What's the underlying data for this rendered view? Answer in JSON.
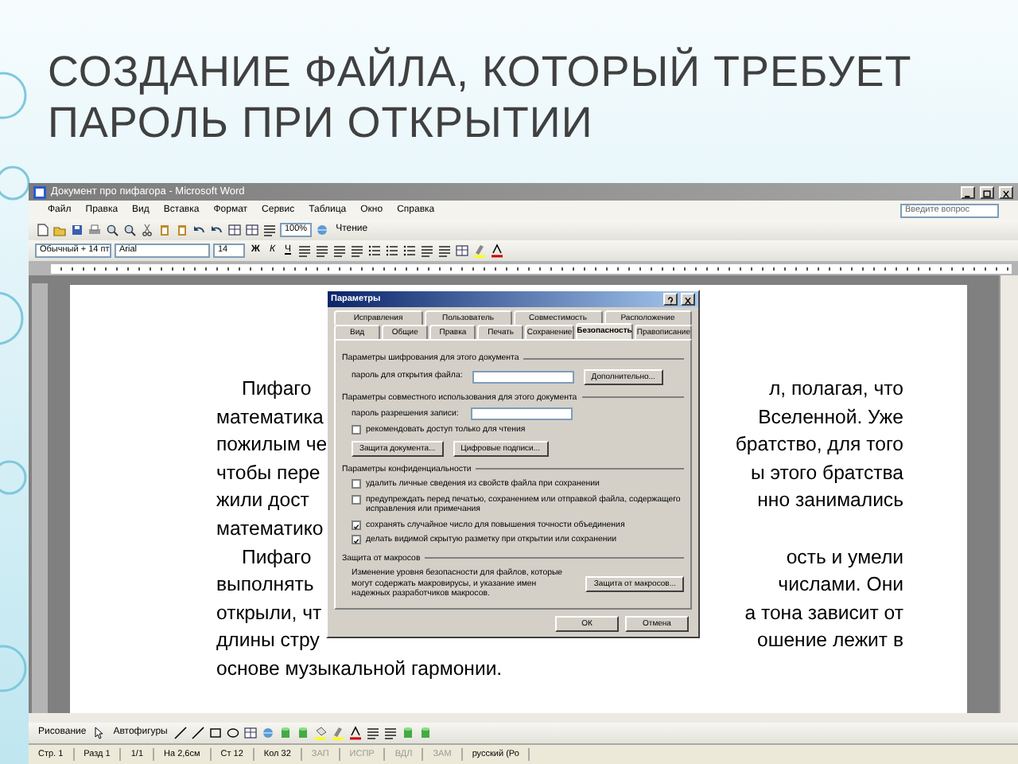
{
  "slide": {
    "title": "СОЗДАНИЕ ФАЙЛА, КОТОРЫЙ ТРЕБУЕТ ПАРОЛЬ ПРИ ОТКРЫТИИ"
  },
  "word": {
    "title": "Документ про пифагора - Microsoft Word",
    "menu": [
      "Файл",
      "Правка",
      "Вид",
      "Вставка",
      "Формат",
      "Сервис",
      "Таблица",
      "Окно",
      "Справка"
    ],
    "help_field": {
      "placeholder": "Введите вопрос"
    },
    "standard_toolbar": {
      "zoom": "100%",
      "read_button": "Чтение"
    },
    "formatting_toolbar": {
      "style": "Обычный + 14 пт",
      "font": "Arial",
      "size": "14",
      "format_buttons": [
        "Ж",
        "К",
        "Ч"
      ]
    },
    "document": {
      "lines": [
        {
          "left": "Пифаго",
          "right": "л, полагая, что",
          "indent": true
        },
        {
          "left": "математика",
          "right": "Вселенной. Уже",
          "indent": false
        },
        {
          "left": "пожилым че",
          "right": "братство, для того",
          "indent": false
        },
        {
          "left": "чтобы пере",
          "right": "ы этого братства",
          "indent": false
        },
        {
          "left": "жили дост",
          "right": "нно занимались",
          "indent": false
        },
        {
          "left": "математико",
          "indent": false
        },
        {
          "left": "Пифаго",
          "right": "ость и умели",
          "indent": true
        },
        {
          "left": "выполнять",
          "right": "числами. Они",
          "indent": false
        },
        {
          "left": "открыли, чт",
          "right": "а тона зависит от",
          "indent": false
        },
        {
          "left": "длины стру",
          "right": "ошение лежит в",
          "indent": false
        },
        {
          "left": "основе музыкальной гармонии.",
          "indent": false
        }
      ]
    },
    "drawing_toolbar": {
      "draw_menu": "Рисование",
      "autoshapes_menu": "Автофигуры"
    },
    "status_bar": {
      "items": [
        {
          "text": "Стр. 1",
          "disabled": false
        },
        {
          "text": "Разд 1",
          "disabled": false
        },
        {
          "text": "1/1",
          "disabled": false
        },
        {
          "text": "На 2,6см",
          "disabled": false
        },
        {
          "text": "Ст 12",
          "disabled": false
        },
        {
          "text": "Кол 32",
          "disabled": false
        },
        {
          "text": "ЗАП",
          "disabled": true
        },
        {
          "text": "ИСПР",
          "disabled": true
        },
        {
          "text": "ВДЛ",
          "disabled": true
        },
        {
          "text": "ЗАМ",
          "disabled": true
        },
        {
          "text": "русский (Ро",
          "disabled": false
        }
      ]
    }
  },
  "dialog": {
    "title": "Параметры",
    "tabs_top": [
      {
        "label": "Исправления",
        "selected": false
      },
      {
        "label": "Пользователь",
        "selected": false
      },
      {
        "label": "Совместимость",
        "selected": false
      },
      {
        "label": "Расположение",
        "selected": false
      }
    ],
    "tabs_bottom": [
      {
        "label": "Вид",
        "selected": false
      },
      {
        "label": "Общие",
        "selected": false
      },
      {
        "label": "Правка",
        "selected": false
      },
      {
        "label": "Печать",
        "selected": false
      },
      {
        "label": "Сохранение",
        "selected": false
      },
      {
        "label": "Безопасность",
        "selected": true
      },
      {
        "label": "Правописание",
        "selected": false
      }
    ],
    "encryption": {
      "heading": "Параметры шифрования для этого документа",
      "password_label": "пароль для открытия файла:",
      "button": "Дополнительно..."
    },
    "sharing": {
      "heading": "Параметры совместного использования для этого документа",
      "password_label": "пароль разрешения записи:",
      "readonly": {
        "label": "рекомендовать доступ только для чтения",
        "checked": false
      },
      "buttons": [
        "Защита документа...",
        "Цифровые подписи..."
      ]
    },
    "privacy": {
      "heading": "Параметры конфиденциальности",
      "options": [
        {
          "label": "удалить личные сведения из свойств файла при сохранении",
          "checked": false
        },
        {
          "label": "предупреждать перед печатью, сохранением или отправкой файла, содержащего исправления или примечания",
          "checked": false
        },
        {
          "label": "сохранять случайное число для повышения точности объединения",
          "checked": true
        },
        {
          "label": "делать видимой скрытую разметку при открытии или сохранении",
          "checked": true
        }
      ]
    },
    "macro": {
      "heading": "Защита от макросов",
      "text": "Изменение уровня безопасности для файлов, которые могут содержать макровирусы, и указание имен надежных разработчиков макросов.",
      "button": "Защита от макросов..."
    },
    "buttons": [
      "ОК",
      "Отмена"
    ]
  }
}
